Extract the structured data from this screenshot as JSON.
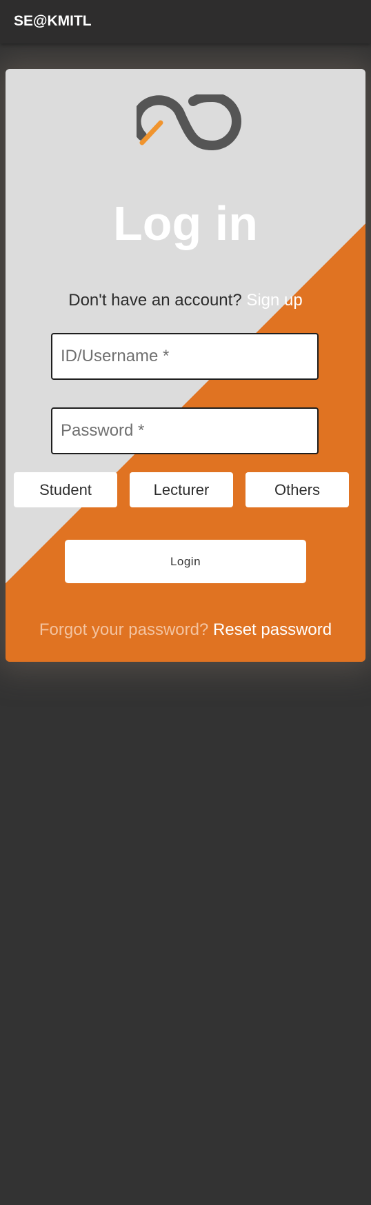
{
  "navbar": {
    "brand": "SE@KMITL"
  },
  "login": {
    "title": "Log in",
    "signup_prompt": "Don't have an account?",
    "signup_link": "Sign up",
    "username_placeholder": "ID/Username *",
    "username_value": "",
    "password_placeholder": "Password *",
    "password_value": "",
    "roles": [
      "Student",
      "Lecturer",
      "Others"
    ],
    "submit_label": "Login",
    "forgot_prompt": "Forgot your password?",
    "reset_link": "Reset password"
  },
  "colors": {
    "page_background": "#333333",
    "navbar_background": "#2e2d2d",
    "card_gray": "#dcdcdc",
    "accent_orange": "#e07322",
    "logo_gray": "#555555",
    "logo_orange": "#f0942e"
  },
  "icons": {
    "logo": "se-kmitl-logo-icon"
  }
}
